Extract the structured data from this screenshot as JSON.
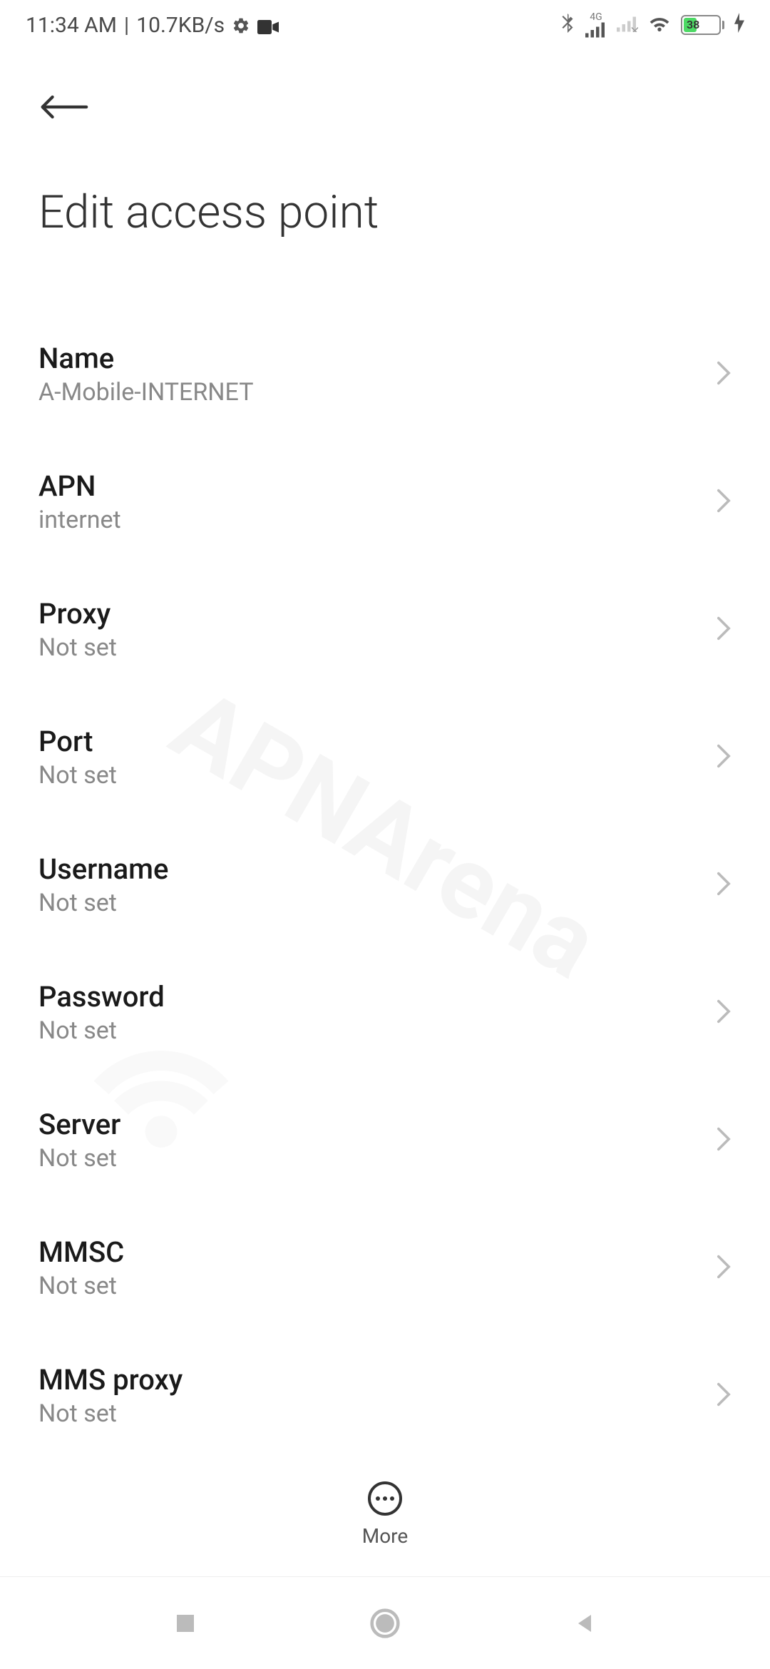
{
  "statusBar": {
    "time": "11:34 AM",
    "dataSpeed": "10.7KB/s",
    "networkType": "4G",
    "batteryPercent": "38"
  },
  "header": {
    "title": "Edit access point"
  },
  "settings": [
    {
      "label": "Name",
      "value": "A-Mobile-INTERNET"
    },
    {
      "label": "APN",
      "value": "internet"
    },
    {
      "label": "Proxy",
      "value": "Not set"
    },
    {
      "label": "Port",
      "value": "Not set"
    },
    {
      "label": "Username",
      "value": "Not set"
    },
    {
      "label": "Password",
      "value": "Not set"
    },
    {
      "label": "Server",
      "value": "Not set"
    },
    {
      "label": "MMSC",
      "value": "Not set"
    },
    {
      "label": "MMS proxy",
      "value": "Not set"
    }
  ],
  "bottomBar": {
    "moreLabel": "More"
  },
  "watermark": "APNArena"
}
